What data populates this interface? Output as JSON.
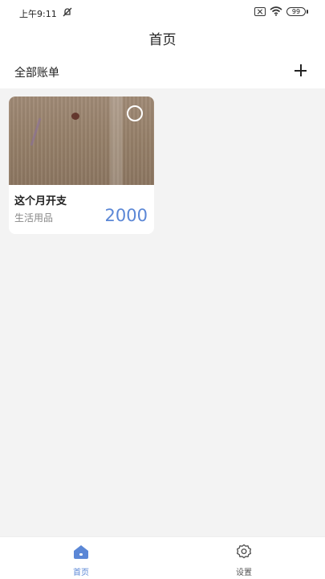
{
  "status_bar": {
    "time": "上午9:11",
    "battery": "99"
  },
  "header": {
    "title": "首页"
  },
  "section": {
    "label": "全部账单"
  },
  "bills": [
    {
      "title": "这个月开支",
      "category": "生活用品",
      "amount": "2000"
    }
  ],
  "tabs": [
    {
      "label": "首页",
      "icon": "home-icon",
      "active": true
    },
    {
      "label": "设置",
      "icon": "gear-icon",
      "active": false
    }
  ],
  "colors": {
    "accent": "#5b87d6",
    "background": "#f3f3f3"
  }
}
